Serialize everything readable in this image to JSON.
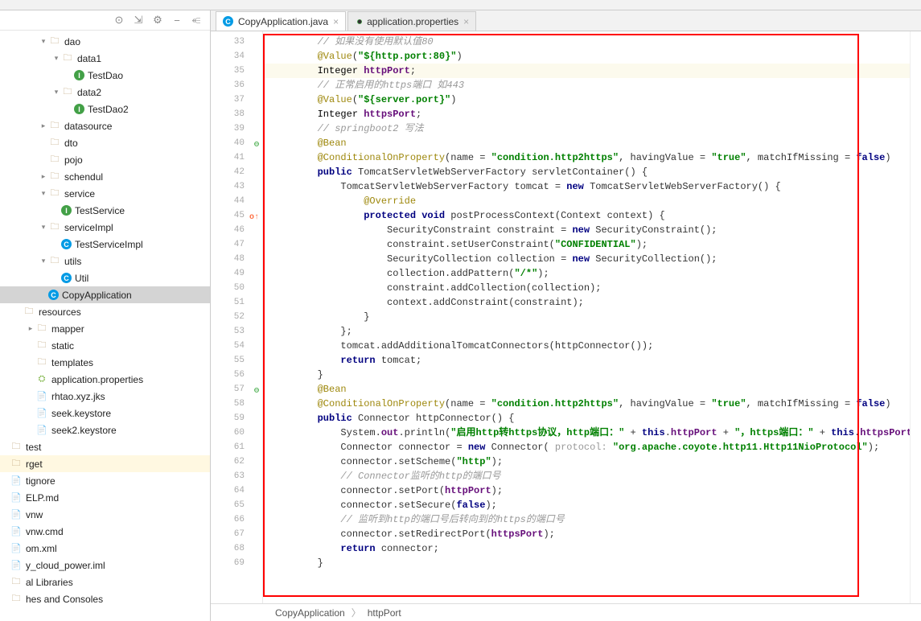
{
  "tabs": [
    {
      "label": "CopyApplication.java",
      "icon": "C",
      "icon_class": "class-c",
      "active": true
    },
    {
      "label": "application.properties",
      "icon": "●",
      "icon_class": "leaf",
      "active": false
    }
  ],
  "tree": [
    {
      "indent": 2,
      "chev": "▾",
      "icon": "folder",
      "glyph": "🗀",
      "label": "dao"
    },
    {
      "indent": 3,
      "chev": "▾",
      "icon": "folder",
      "glyph": "🗀",
      "label": "data1"
    },
    {
      "indent": 4,
      "chev": "",
      "icon": "class-i",
      "glyph": "I",
      "label": "TestDao"
    },
    {
      "indent": 3,
      "chev": "▾",
      "icon": "folder",
      "glyph": "🗀",
      "label": "data2"
    },
    {
      "indent": 4,
      "chev": "",
      "icon": "class-i",
      "glyph": "I",
      "label": "TestDao2"
    },
    {
      "indent": 2,
      "chev": "▸",
      "icon": "folder",
      "glyph": "🗀",
      "label": "datasource"
    },
    {
      "indent": 2,
      "chev": "",
      "icon": "folder",
      "glyph": "🗀",
      "label": "dto"
    },
    {
      "indent": 2,
      "chev": "",
      "icon": "folder",
      "glyph": "🗀",
      "label": "pojo"
    },
    {
      "indent": 2,
      "chev": "▸",
      "icon": "folder",
      "glyph": "🗀",
      "label": "schendul"
    },
    {
      "indent": 2,
      "chev": "▾",
      "icon": "folder",
      "glyph": "🗀",
      "label": "service"
    },
    {
      "indent": 3,
      "chev": "",
      "icon": "class-i",
      "glyph": "I",
      "label": "TestService"
    },
    {
      "indent": 2,
      "chev": "▾",
      "icon": "folder",
      "glyph": "🗀",
      "label": "serviceImpl"
    },
    {
      "indent": 3,
      "chev": "",
      "icon": "class-c",
      "glyph": "C",
      "label": "TestServiceImpl"
    },
    {
      "indent": 2,
      "chev": "▾",
      "icon": "folder",
      "glyph": "🗀",
      "label": "utils"
    },
    {
      "indent": 3,
      "chev": "",
      "icon": "class-c",
      "glyph": "C",
      "label": "Util"
    },
    {
      "indent": 2,
      "chev": "",
      "icon": "class-c",
      "glyph": "C",
      "label": "CopyApplication",
      "selected": true
    },
    {
      "indent": 0,
      "chev": "",
      "icon": "folder",
      "glyph": "🗀",
      "label": "resources"
    },
    {
      "indent": 1,
      "chev": "▸",
      "icon": "folder",
      "glyph": "🗀",
      "label": "mapper"
    },
    {
      "indent": 1,
      "chev": "",
      "icon": "folder",
      "glyph": "🗀",
      "label": "static"
    },
    {
      "indent": 1,
      "chev": "",
      "icon": "folder",
      "glyph": "🗀",
      "label": "templates"
    },
    {
      "indent": 1,
      "chev": "",
      "icon": "prop",
      "glyph": "⛭",
      "label": "application.properties"
    },
    {
      "indent": 1,
      "chev": "",
      "icon": "file",
      "glyph": "📄",
      "label": "rhtao.xyz.jks"
    },
    {
      "indent": 1,
      "chev": "",
      "icon": "file",
      "glyph": "📄",
      "label": "seek.keystore"
    },
    {
      "indent": 1,
      "chev": "",
      "icon": "file",
      "glyph": "📄",
      "label": "seek2.keystore"
    },
    {
      "indent": -1,
      "chev": "",
      "icon": "folder",
      "glyph": "🗀",
      "label": "test"
    },
    {
      "indent": -1,
      "chev": "",
      "icon": "folder",
      "glyph": "🗀",
      "label": "rget",
      "hl": "target-hl"
    },
    {
      "indent": -1,
      "chev": "",
      "icon": "file",
      "glyph": "📄",
      "label": "tignore"
    },
    {
      "indent": -1,
      "chev": "",
      "icon": "file",
      "glyph": "📄",
      "label": "ELP.md"
    },
    {
      "indent": -1,
      "chev": "",
      "icon": "file",
      "glyph": "📄",
      "label": "vnw"
    },
    {
      "indent": -1,
      "chev": "",
      "icon": "file",
      "glyph": "📄",
      "label": "vnw.cmd"
    },
    {
      "indent": -1,
      "chev": "",
      "icon": "file",
      "glyph": "📄",
      "label": "om.xml"
    },
    {
      "indent": -1,
      "chev": "",
      "icon": "file",
      "glyph": "📄",
      "label": "y_cloud_power.iml"
    },
    {
      "indent": -1,
      "chev": "",
      "icon": "folder",
      "glyph": "🗀",
      "label": "al Libraries"
    },
    {
      "indent": -1,
      "chev": "",
      "icon": "folder",
      "glyph": "🗀",
      "label": "hes and Consoles"
    }
  ],
  "code_lines": [
    {
      "n": 33,
      "tokens": [
        {
          "t": "        ",
          "c": ""
        },
        {
          "t": "// 如果没有使用默认值80",
          "c": "c-comment"
        }
      ]
    },
    {
      "n": 34,
      "tokens": [
        {
          "t": "        ",
          "c": ""
        },
        {
          "t": "@Value",
          "c": "c-ann"
        },
        {
          "t": "(",
          "c": ""
        },
        {
          "t": "\"${http.port:80}\"",
          "c": "c-str"
        },
        {
          "t": ")",
          "c": ""
        }
      ]
    },
    {
      "n": 35,
      "hl": true,
      "tokens": [
        {
          "t": "        ",
          "c": ""
        },
        {
          "t": "Integer ",
          "c": "c-type"
        },
        {
          "t": "httpPort",
          "c": "c-field"
        },
        {
          "t": ";",
          "c": ""
        }
      ]
    },
    {
      "n": 36,
      "tokens": [
        {
          "t": "        ",
          "c": ""
        },
        {
          "t": "// 正常启用的https端口 如443",
          "c": "c-comment"
        }
      ]
    },
    {
      "n": 37,
      "tokens": [
        {
          "t": "        ",
          "c": ""
        },
        {
          "t": "@Value",
          "c": "c-ann"
        },
        {
          "t": "(",
          "c": ""
        },
        {
          "t": "\"${server.port}\"",
          "c": "c-str"
        },
        {
          "t": ")",
          "c": ""
        }
      ]
    },
    {
      "n": 38,
      "tokens": [
        {
          "t": "        ",
          "c": ""
        },
        {
          "t": "Integer ",
          "c": "c-type"
        },
        {
          "t": "httpsPort",
          "c": "c-field"
        },
        {
          "t": ";",
          "c": ""
        }
      ]
    },
    {
      "n": 39,
      "tokens": [
        {
          "t": "        ",
          "c": ""
        },
        {
          "t": "// springboot2 写法",
          "c": "c-comment"
        }
      ]
    },
    {
      "n": 40,
      "mark": "⊖",
      "markc": "gm-green",
      "tokens": [
        {
          "t": "        ",
          "c": ""
        },
        {
          "t": "@Bean",
          "c": "c-ann"
        }
      ]
    },
    {
      "n": 41,
      "tokens": [
        {
          "t": "        ",
          "c": ""
        },
        {
          "t": "@ConditionalOnProperty",
          "c": "c-ann"
        },
        {
          "t": "(name = ",
          "c": ""
        },
        {
          "t": "\"condition.http2https\"",
          "c": "c-str"
        },
        {
          "t": ", havingValue = ",
          "c": ""
        },
        {
          "t": "\"true\"",
          "c": "c-str"
        },
        {
          "t": ", matchIfMissing = ",
          "c": ""
        },
        {
          "t": "false",
          "c": "c-kw"
        },
        {
          "t": ")",
          "c": ""
        }
      ]
    },
    {
      "n": 42,
      "tokens": [
        {
          "t": "        ",
          "c": ""
        },
        {
          "t": "public ",
          "c": "c-kw"
        },
        {
          "t": "TomcatServletWebServerFactory servletContainer() {",
          "c": ""
        }
      ]
    },
    {
      "n": 43,
      "tokens": [
        {
          "t": "            ",
          "c": ""
        },
        {
          "t": "TomcatServletWebServerFactory tomcat = ",
          "c": ""
        },
        {
          "t": "new ",
          "c": "c-kw"
        },
        {
          "t": "TomcatServletWebServerFactory() {",
          "c": ""
        }
      ]
    },
    {
      "n": 44,
      "tokens": [
        {
          "t": "                ",
          "c": ""
        },
        {
          "t": "@Override",
          "c": "c-ann"
        }
      ]
    },
    {
      "n": 45,
      "mark": "o↑",
      "markc": "gm-orange",
      "tokens": [
        {
          "t": "                ",
          "c": ""
        },
        {
          "t": "protected void ",
          "c": "c-kw"
        },
        {
          "t": "postProcessContext(Context context) {",
          "c": ""
        }
      ]
    },
    {
      "n": 46,
      "tokens": [
        {
          "t": "                    ",
          "c": ""
        },
        {
          "t": "SecurityConstraint constraint = ",
          "c": ""
        },
        {
          "t": "new ",
          "c": "c-kw"
        },
        {
          "t": "SecurityConstraint();",
          "c": ""
        }
      ]
    },
    {
      "n": 47,
      "tokens": [
        {
          "t": "                    ",
          "c": ""
        },
        {
          "t": "constraint.setUserConstraint(",
          "c": ""
        },
        {
          "t": "\"CONFIDENTIAL\"",
          "c": "c-str"
        },
        {
          "t": ");",
          "c": ""
        }
      ]
    },
    {
      "n": 48,
      "tokens": [
        {
          "t": "                    ",
          "c": ""
        },
        {
          "t": "SecurityCollection collection = ",
          "c": ""
        },
        {
          "t": "new ",
          "c": "c-kw"
        },
        {
          "t": "SecurityCollection();",
          "c": ""
        }
      ]
    },
    {
      "n": 49,
      "tokens": [
        {
          "t": "                    ",
          "c": ""
        },
        {
          "t": "collection.addPattern(",
          "c": ""
        },
        {
          "t": "\"/*\"",
          "c": "c-str"
        },
        {
          "t": ");",
          "c": ""
        }
      ]
    },
    {
      "n": 50,
      "tokens": [
        {
          "t": "                    ",
          "c": ""
        },
        {
          "t": "constraint.addCollection(collection);",
          "c": ""
        }
      ]
    },
    {
      "n": 51,
      "tokens": [
        {
          "t": "                    ",
          "c": ""
        },
        {
          "t": "context.addConstraint(constraint);",
          "c": ""
        }
      ]
    },
    {
      "n": 52,
      "tokens": [
        {
          "t": "                }",
          "c": ""
        }
      ]
    },
    {
      "n": 53,
      "tokens": [
        {
          "t": "            };",
          "c": ""
        }
      ]
    },
    {
      "n": 54,
      "tokens": [
        {
          "t": "            ",
          "c": ""
        },
        {
          "t": "tomcat.addAdditionalTomcatConnectors(httpConnector());",
          "c": ""
        }
      ]
    },
    {
      "n": 55,
      "tokens": [
        {
          "t": "            ",
          "c": ""
        },
        {
          "t": "return ",
          "c": "c-kw"
        },
        {
          "t": "tomcat;",
          "c": ""
        }
      ]
    },
    {
      "n": 56,
      "tokens": [
        {
          "t": "        }",
          "c": ""
        }
      ]
    },
    {
      "n": 57,
      "mark": "⊖",
      "markc": "gm-green",
      "tokens": [
        {
          "t": "        ",
          "c": ""
        },
        {
          "t": "@Bean",
          "c": "c-ann"
        }
      ]
    },
    {
      "n": 58,
      "tokens": [
        {
          "t": "        ",
          "c": ""
        },
        {
          "t": "@ConditionalOnProperty",
          "c": "c-ann"
        },
        {
          "t": "(name = ",
          "c": ""
        },
        {
          "t": "\"condition.http2https\"",
          "c": "c-str"
        },
        {
          "t": ", havingValue = ",
          "c": ""
        },
        {
          "t": "\"true\"",
          "c": "c-str"
        },
        {
          "t": ", matchIfMissing = ",
          "c": ""
        },
        {
          "t": "false",
          "c": "c-kw"
        },
        {
          "t": ")",
          "c": ""
        }
      ]
    },
    {
      "n": 59,
      "tokens": [
        {
          "t": "        ",
          "c": ""
        },
        {
          "t": "public ",
          "c": "c-kw"
        },
        {
          "t": "Connector httpConnector() {",
          "c": ""
        }
      ]
    },
    {
      "n": 60,
      "tokens": [
        {
          "t": "            ",
          "c": ""
        },
        {
          "t": "System.",
          "c": ""
        },
        {
          "t": "out",
          "c": "c-field"
        },
        {
          "t": ".println(",
          "c": ""
        },
        {
          "t": "\"启用http转https协议，http端口：\"",
          "c": "c-str"
        },
        {
          "t": " + ",
          "c": ""
        },
        {
          "t": "this",
          "c": "c-kw"
        },
        {
          "t": ".",
          "c": ""
        },
        {
          "t": "httpPort",
          "c": "c-field"
        },
        {
          "t": " + ",
          "c": ""
        },
        {
          "t": "\"，https端口：\"",
          "c": "c-str"
        },
        {
          "t": " + ",
          "c": ""
        },
        {
          "t": "this",
          "c": "c-kw"
        },
        {
          "t": ".",
          "c": ""
        },
        {
          "t": "httpsPort",
          "c": "c-field"
        },
        {
          "t": ");",
          "c": ""
        }
      ]
    },
    {
      "n": 61,
      "tokens": [
        {
          "t": "            ",
          "c": ""
        },
        {
          "t": "Connector connector = ",
          "c": ""
        },
        {
          "t": "new ",
          "c": "c-kw"
        },
        {
          "t": "Connector( ",
          "c": ""
        },
        {
          "t": "protocol: ",
          "c": "c-param"
        },
        {
          "t": "\"org.apache.coyote.http11.Http11NioProtocol\"",
          "c": "c-str"
        },
        {
          "t": ");",
          "c": ""
        }
      ]
    },
    {
      "n": 62,
      "tokens": [
        {
          "t": "            ",
          "c": ""
        },
        {
          "t": "connector.setScheme(",
          "c": ""
        },
        {
          "t": "\"http\"",
          "c": "c-str"
        },
        {
          "t": ");",
          "c": ""
        }
      ]
    },
    {
      "n": 63,
      "tokens": [
        {
          "t": "            ",
          "c": ""
        },
        {
          "t": "// Connector监听的http的端口号",
          "c": "c-comment"
        }
      ]
    },
    {
      "n": 64,
      "tokens": [
        {
          "t": "            ",
          "c": ""
        },
        {
          "t": "connector.setPort(",
          "c": ""
        },
        {
          "t": "httpPort",
          "c": "c-field"
        },
        {
          "t": ");",
          "c": ""
        }
      ]
    },
    {
      "n": 65,
      "tokens": [
        {
          "t": "            ",
          "c": ""
        },
        {
          "t": "connector.setSecure(",
          "c": ""
        },
        {
          "t": "false",
          "c": "c-kw"
        },
        {
          "t": ");",
          "c": ""
        }
      ]
    },
    {
      "n": 66,
      "tokens": [
        {
          "t": "            ",
          "c": ""
        },
        {
          "t": "// 监听到http的端口号后转向到的https的端口号",
          "c": "c-comment"
        }
      ]
    },
    {
      "n": 67,
      "tokens": [
        {
          "t": "            ",
          "c": ""
        },
        {
          "t": "connector.setRedirectPort(",
          "c": ""
        },
        {
          "t": "httpsPort",
          "c": "c-field"
        },
        {
          "t": ");",
          "c": ""
        }
      ]
    },
    {
      "n": 68,
      "tokens": [
        {
          "t": "            ",
          "c": ""
        },
        {
          "t": "return ",
          "c": "c-kw"
        },
        {
          "t": "connector;",
          "c": ""
        }
      ]
    },
    {
      "n": 69,
      "tokens": [
        {
          "t": "        }",
          "c": ""
        }
      ]
    }
  ],
  "breadcrumb": [
    "CopyApplication",
    "httpPort"
  ],
  "toolbar_icons": {
    "target": "⊙",
    "expand": "⇲",
    "gear": "⚙",
    "min": "−",
    "hide": "⥺"
  }
}
